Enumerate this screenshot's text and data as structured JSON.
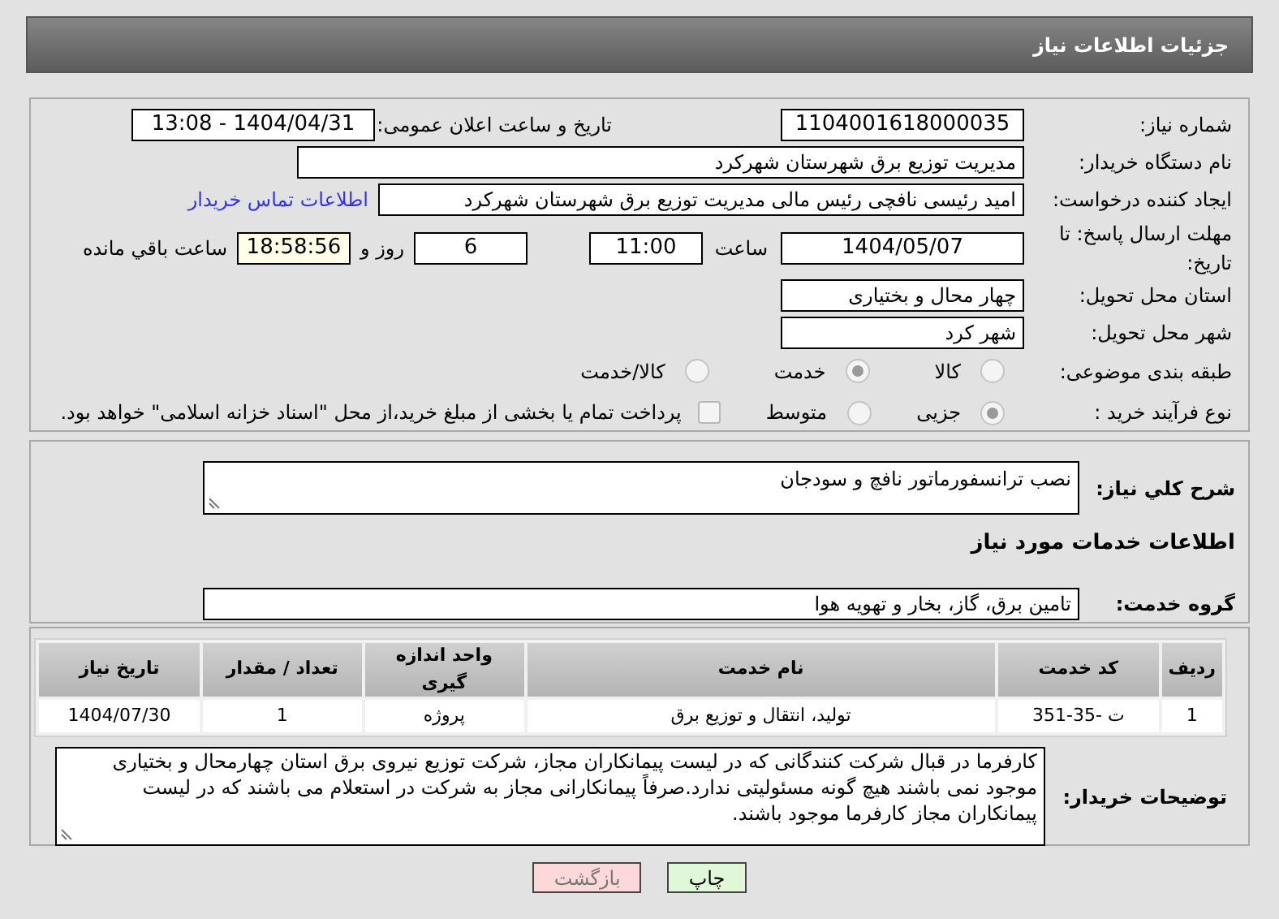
{
  "header": {
    "title": "جزئیات اطلاعات نیاز"
  },
  "details": {
    "need_number": {
      "label": "شماره نیاز:",
      "value": "1104001618000035"
    },
    "announce": {
      "label": "تاریخ و ساعت اعلان عمومی:",
      "value": "1404/04/31 - 13:08"
    },
    "buyer_org": {
      "label": "نام دستگاه خریدار:",
      "value": "مدیریت توزیع برق شهرستان شهرکرد"
    },
    "requester": {
      "label": "ایجاد کننده درخواست:",
      "value": "امید رئیسی نافچی رئیس مالی مدیریت توزیع برق شهرستان شهرکرد",
      "link": "اطلاعات تماس خریدار"
    },
    "deadline": {
      "label": "مهلت ارسال پاسخ: تا تاریخ:",
      "date": "1404/05/07",
      "time_label": "ساعت",
      "time": "11:00",
      "days": "6",
      "days_label": "روز و",
      "remaining": "18:58:56",
      "remaining_label": "ساعت باقي مانده"
    },
    "province": {
      "label": "استان محل تحویل:",
      "value": "چهار محال و بختیاری"
    },
    "city": {
      "label": "شهر محل تحویل:",
      "value": "شهر کرد"
    },
    "category": {
      "label": "طبقه بندی موضوعی:",
      "options": [
        {
          "label": "كالا",
          "selected": false
        },
        {
          "label": "خدمت",
          "selected": true
        },
        {
          "label": "كالا/خدمت",
          "selected": false
        }
      ]
    },
    "process": {
      "label": "نوع فرآیند خرید :",
      "options": [
        {
          "label": "جزیی",
          "selected": true
        },
        {
          "label": "متوسط",
          "selected": false
        }
      ],
      "payment": {
        "label": "پرداخت تمام یا بخشی از مبلغ خرید،از محل \"اسناد خزانه اسلامی\" خواهد بود.",
        "checked": false
      }
    }
  },
  "summary": {
    "label": "شرح کلي نیاز:",
    "value": "نصب ترانسفورماتور نافچ و سودجان"
  },
  "services": {
    "heading": "اطلاعات خدمات مورد نیاز",
    "group_label": "گروه خدمت:",
    "group": "تامین برق، گاز، بخار و تهویه هوا",
    "table": {
      "columns": [
        "ردیف",
        "کد خدمت",
        "نام خدمت",
        "واحد اندازه گیری",
        "تعداد / مقدار",
        "تاریخ نیاز"
      ],
      "rows": [
        [
          "1",
          "ت -35-351",
          "تولید، انتقال و توزیع برق",
          "پروژه",
          "1",
          "1404/07/30"
        ]
      ]
    }
  },
  "notes": {
    "label": "توضیحات خریدار:",
    "value": "کارفرما در قبال شرکت کنندگانی که در لیست پیمانکاران مجاز، شرکت توزیع نیروی برق استان چهارمحال و بختیاری موجود نمی باشند هیچ گونه مسئولیتی ندارد.صرفاً پیمانکارانی مجاز به شرکت در استعلام می باشند که در لیست پیمانکاران مجاز کارفرما موجود باشند."
  },
  "buttons": [
    {
      "label": "چاپ",
      "kind": "print"
    },
    {
      "label": "بازگشت",
      "kind": "back"
    }
  ]
}
